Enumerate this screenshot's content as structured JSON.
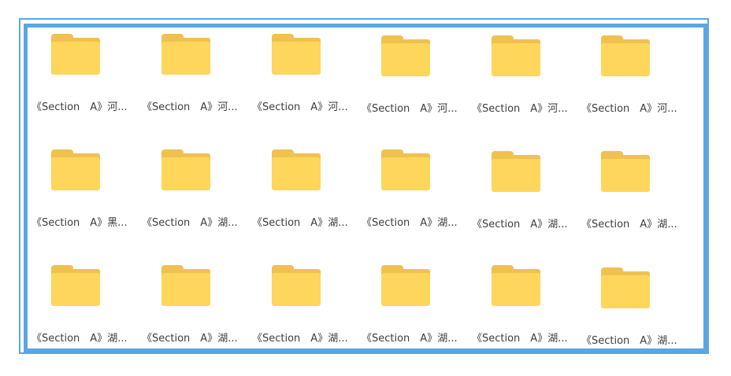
{
  "folders": [
    {
      "label": "《Section　A》河..."
    },
    {
      "label": "《Section　A》河..."
    },
    {
      "label": "《Section　A》河..."
    },
    {
      "label": "《Section　A》河..."
    },
    {
      "label": "《Section　A》河..."
    },
    {
      "label": "《Section　A》河..."
    },
    {
      "label": "《Section　A》黑..."
    },
    {
      "label": "《Section　A》湖..."
    },
    {
      "label": "《Section　A》湖..."
    },
    {
      "label": "《Section　A》湖..."
    },
    {
      "label": "《Section　A》湖..."
    },
    {
      "label": "《Section　A》湖..."
    },
    {
      "label": "《Section　A》湖..."
    },
    {
      "label": "《Section　A》湖..."
    },
    {
      "label": "《Section　A》湖..."
    },
    {
      "label": "《Section　A》湖..."
    },
    {
      "label": "《Section　A》湖..."
    },
    {
      "label": "《Section　A》湖..."
    }
  ],
  "icon": "folder-icon",
  "colors": {
    "frame": "#5ba7e4",
    "folder_front": "#ffd65c",
    "folder_back": "#f0c14f",
    "label_text": "#3d3d3d"
  }
}
